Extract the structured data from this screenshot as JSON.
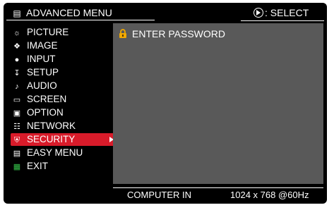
{
  "header": {
    "title": "ADVANCED MENU",
    "title_icon": "menu-icon",
    "select_hint": ": SELECT",
    "select_icon": "select-button-icon"
  },
  "menu": {
    "items": [
      {
        "label": "PICTURE",
        "icon": "picture-icon"
      },
      {
        "label": "IMAGE",
        "icon": "image-icon"
      },
      {
        "label": "INPUT",
        "icon": "input-icon"
      },
      {
        "label": "SETUP",
        "icon": "setup-icon"
      },
      {
        "label": "AUDIO",
        "icon": "audio-icon"
      },
      {
        "label": "SCREEN",
        "icon": "screen-icon"
      },
      {
        "label": "OPTION",
        "icon": "option-icon"
      },
      {
        "label": "NETWORK",
        "icon": "network-icon"
      },
      {
        "label": "SECURITY",
        "icon": "security-icon",
        "selected": true
      },
      {
        "label": "EASY MENU",
        "icon": "easy-menu-icon"
      },
      {
        "label": "EXIT",
        "icon": "exit-icon"
      }
    ],
    "selected_color": "#d81b2a"
  },
  "panel": {
    "item_label": "ENTER PASSWORD",
    "item_icon": "lock-icon",
    "background": "#595959"
  },
  "status": {
    "source": "COMPUTER IN",
    "resolution": "1024 x 768 @60Hz"
  }
}
